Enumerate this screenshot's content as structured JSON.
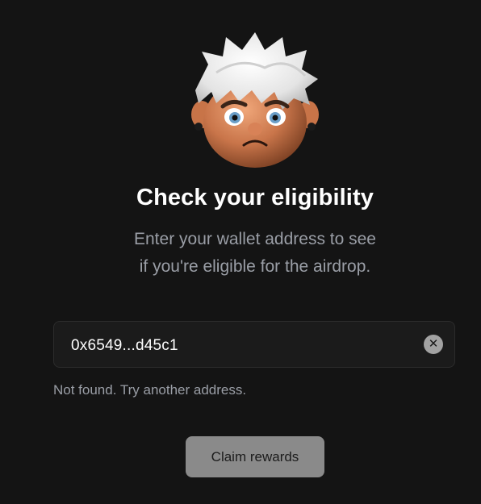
{
  "hero": {
    "avatar_icon": "sad-avatar-icon",
    "title": "Check your eligibility",
    "subtitle_line1": "Enter your wallet address to see",
    "subtitle_line2": "if you're eligible for the airdrop."
  },
  "address_input": {
    "value": "0x6549...d45c1",
    "clear_icon": "close-icon",
    "clear_glyph": "✕"
  },
  "status": {
    "message": "Not found. Try another address."
  },
  "actions": {
    "claim_label": "Claim rewards"
  },
  "colors": {
    "background": "#141414",
    "input_background": "#1b1b1b",
    "button_disabled": "#8a8a8a",
    "muted_text": "#9a9ea6"
  }
}
